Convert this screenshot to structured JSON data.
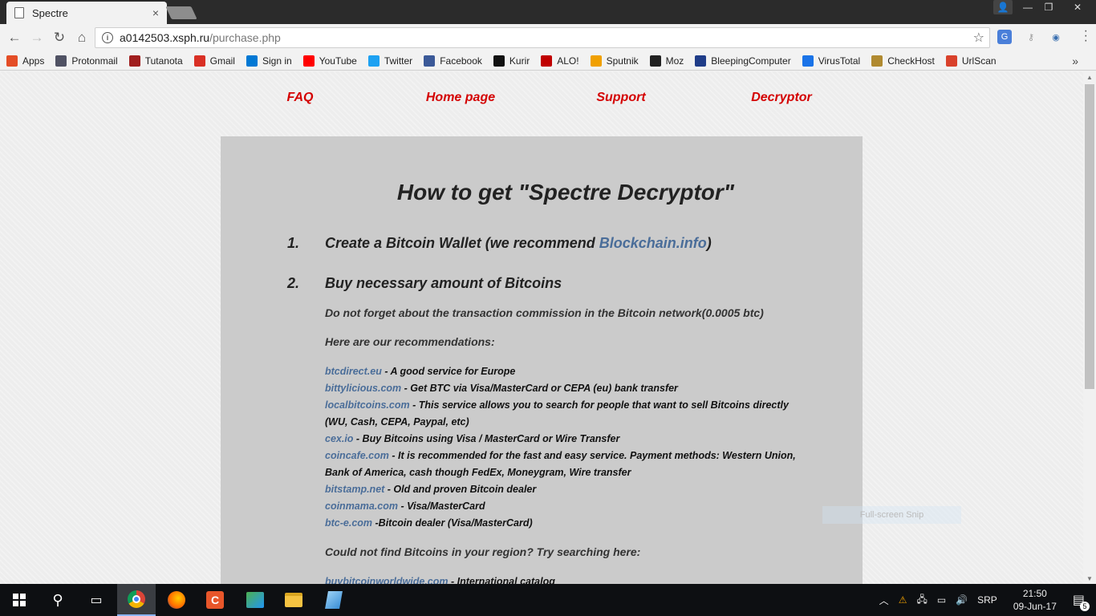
{
  "browser": {
    "tab_title": "Spectre",
    "tab_close": "×",
    "url_host": "a0142503.xsph.ru",
    "url_path": "/purchase.php",
    "bookmarks": [
      {
        "label": "Apps",
        "icon": "apps-grid-icon",
        "color": "#e44d26"
      },
      {
        "label": "Protonmail",
        "icon": "protonmail-icon",
        "color": "#505264"
      },
      {
        "label": "Tutanota",
        "icon": "tutanota-icon",
        "color": "#a01e1e"
      },
      {
        "label": "Gmail",
        "icon": "gmail-icon",
        "color": "#d93025"
      },
      {
        "label": "Sign in",
        "icon": "microsoft-icon",
        "color": "#0078d4"
      },
      {
        "label": "YouTube",
        "icon": "youtube-icon",
        "color": "#ff0000"
      },
      {
        "label": "Twitter",
        "icon": "twitter-icon",
        "color": "#1da1f2"
      },
      {
        "label": "Facebook",
        "icon": "facebook-icon",
        "color": "#3b5998"
      },
      {
        "label": "Kurir",
        "icon": "kurir-icon",
        "color": "#111111"
      },
      {
        "label": "ALO!",
        "icon": "alo-icon",
        "color": "#c00000"
      },
      {
        "label": "Sputnik",
        "icon": "sputnik-icon",
        "color": "#f0a000"
      },
      {
        "label": "Moz",
        "icon": "moz-icon",
        "color": "#222222"
      },
      {
        "label": "BleepingComputer",
        "icon": "bleepingcomputer-icon",
        "color": "#1f3c88"
      },
      {
        "label": "VirusTotal",
        "icon": "virustotal-icon",
        "color": "#1a73e8"
      },
      {
        "label": "CheckHost",
        "icon": "checkhost-icon",
        "color": "#b08a30"
      },
      {
        "label": "UrlScan",
        "icon": "urlscan-icon",
        "color": "#d9412b"
      }
    ],
    "bookmarks_more": "»"
  },
  "site": {
    "nav": {
      "faq": "FAQ",
      "home": "Home page",
      "support": "Support",
      "decryptor": "Decryptor"
    },
    "heading": "How to get \"Spectre Decryptor\"",
    "step1": {
      "num": "1.",
      "text_before": "Create a Bitcoin Wallet (we recommend ",
      "link": "Blockchain.info",
      "text_after": ")"
    },
    "step2": {
      "num": "2.",
      "text": "Buy necessary amount of Bitcoins"
    },
    "commission_note": "Do not forget about the transaction commission in the Bitcoin network(0.0005 btc)",
    "recommend_heading": "Here are our recommendations:",
    "recommendations": [
      {
        "link": "btcdirect.eu",
        "desc": " - A good service for Europe"
      },
      {
        "link": "bittylicious.com",
        "desc": " - Get BTC via Visa/MasterCard or CEPA (eu) bank transfer"
      },
      {
        "link": "localbitcoins.com",
        "desc": " - This service allows you to search for people that want to sell Bitcoins directly (WU, Cash, CEPA, Paypal, etc)"
      },
      {
        "link": "cex.io",
        "desc": " - Buy Bitcoins using Visa / MasterCard or Wire Transfer"
      },
      {
        "link": "coincafe.com",
        "desc": " - It is recommended for the fast and easy service. Payment methods: Western Union, Bank of America, cash though FedEx, Moneygram, Wire transfer"
      },
      {
        "link": "bitstamp.net",
        "desc": " - Old and proven Bitcoin dealer"
      },
      {
        "link": "coinmama.com",
        "desc": " - Visa/MasterCard"
      },
      {
        "link": "btc-e.com",
        "desc": " -Bitcoin dealer (Visa/MasterCard)"
      }
    ],
    "region_heading": "Could not find Bitcoins in your region? Try searching here:",
    "region_link": {
      "link": "buybitcoinworldwide.com",
      "desc": " - International catalog"
    }
  },
  "overlay": {
    "snip_label": "Full-screen Snip"
  },
  "taskbar": {
    "language": "SRP",
    "time": "21:50",
    "date": "09-Jun-17",
    "notifications": "5"
  },
  "colors": {
    "nav_link": "#d40000",
    "body_link": "#4a6d99",
    "panel_bg": "#cbcbcb"
  }
}
